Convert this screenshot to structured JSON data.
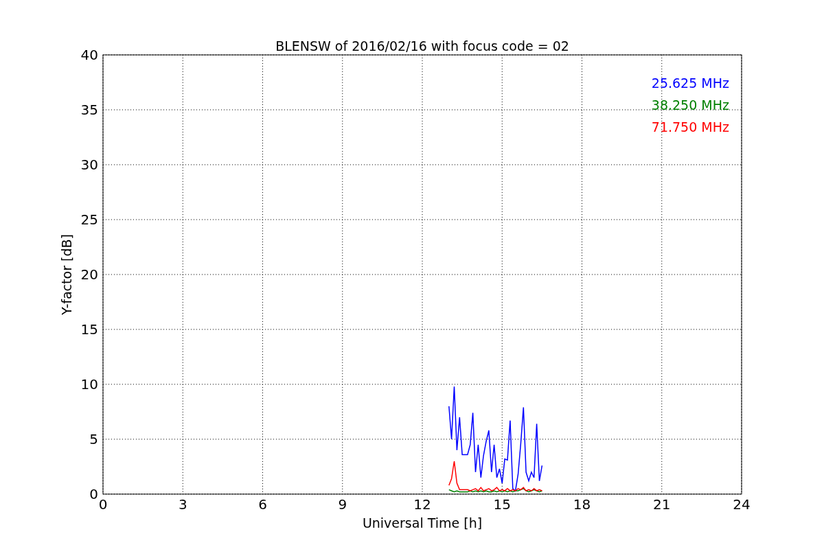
{
  "chart_data": {
    "type": "line",
    "title": "BLENSW of 2016/02/16 with focus code = 02",
    "xlabel": "Universal Time [h]",
    "ylabel": "Y-factor [dB]",
    "x": [
      13.0,
      13.1,
      13.2,
      13.3,
      13.4,
      13.5,
      13.6,
      13.7,
      13.8,
      13.9,
      14.0,
      14.1,
      14.2,
      14.3,
      14.4,
      14.5,
      14.6,
      14.7,
      14.8,
      14.9,
      15.0,
      15.1,
      15.2,
      15.3,
      15.4,
      15.5,
      15.6,
      15.7,
      15.8,
      15.9,
      16.0,
      16.1,
      16.2,
      16.3,
      16.4,
      16.5
    ],
    "series": [
      {
        "name": "25.625 MHz",
        "color": "#0000ff",
        "values": [
          8,
          5,
          9.8,
          4,
          7,
          3.6,
          3.6,
          3.6,
          4.5,
          7.4,
          2,
          4.5,
          1.5,
          3.5,
          4.8,
          5.8,
          2,
          4.5,
          1.5,
          2.3,
          1,
          3.2,
          3.1,
          6.7,
          0.5,
          0.3,
          1.8,
          4.6,
          7.9,
          2,
          1.2,
          2,
          1.5,
          6.4,
          1.2,
          2.6
        ]
      },
      {
        "name": "38.250 MHz",
        "color": "#008000",
        "values": [
          0.4,
          0.3,
          0.2,
          0.3,
          0.2,
          0.2,
          0.2,
          0.2,
          0.3,
          0.2,
          0.3,
          0.2,
          0.3,
          0.2,
          0.3,
          0.2,
          0.2,
          0.3,
          0.2,
          0.3,
          0.2,
          0.3,
          0.2,
          0.3,
          0.2,
          0.3,
          0.3,
          0.4,
          0.5,
          0.3,
          0.2,
          0.3,
          0.4,
          0.3,
          0.2,
          0.3
        ]
      },
      {
        "name": "71.750 MHz",
        "color": "#ff0000",
        "values": [
          0.8,
          1.4,
          3,
          1,
          0.4,
          0.4,
          0.4,
          0.4,
          0.3,
          0.4,
          0.5,
          0.3,
          0.6,
          0.3,
          0.4,
          0.5,
          0.3,
          0.4,
          0.6,
          0.3,
          0.4,
          0.3,
          0.5,
          0.3,
          0.4,
          0.3,
          0.5,
          0.4,
          0.6,
          0.3,
          0.4,
          0.3,
          0.5,
          0.3,
          0.4,
          0.3
        ]
      }
    ],
    "grid": true,
    "xlim": [
      0,
      24
    ],
    "ylim": [
      0,
      40
    ],
    "xticks": [
      0,
      3,
      6,
      9,
      12,
      15,
      18,
      21,
      24
    ],
    "yticks": [
      0,
      5,
      10,
      15,
      20,
      25,
      30,
      35,
      40
    ]
  }
}
